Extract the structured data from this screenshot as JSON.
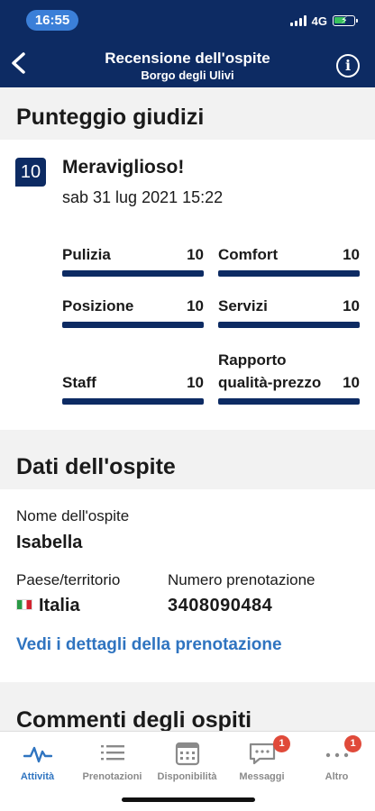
{
  "status": {
    "time": "16:55",
    "network": "4G"
  },
  "header": {
    "title": "Recensione dell'ospite",
    "subtitle": "Borgo degli Ulivi"
  },
  "scores": {
    "section_title": "Punteggio giudizi",
    "overall": "10",
    "overall_label": "Meraviglioso!",
    "date": "sab 31 lug 2021 15:22",
    "criteria": [
      {
        "label": "Pulizia",
        "value": "10",
        "fill": 1.0
      },
      {
        "label": "Comfort",
        "value": "10",
        "fill": 1.0
      },
      {
        "label": "Posizione",
        "value": "10",
        "fill": 1.0
      },
      {
        "label": "Servizi",
        "value": "10",
        "fill": 1.0
      },
      {
        "label": "Staff",
        "value": "10",
        "fill": 1.0
      },
      {
        "label": "Rapporto qualità-prezzo",
        "value": "10",
        "fill": 1.0
      }
    ]
  },
  "guest": {
    "section_title": "Dati dell'ospite",
    "name_label": "Nome dell'ospite",
    "name": "Isabella",
    "country_label": "Paese/territorio",
    "country": "Italia",
    "booking_label": "Numero prenotazione",
    "booking_number": "3408090484",
    "details_link": "Vedi i dettagli della prenotazione"
  },
  "comments": {
    "section_title": "Commenti degli ospiti"
  },
  "tabbar": {
    "tabs": [
      {
        "label": "Attività",
        "icon": "activity-icon",
        "active": true
      },
      {
        "label": "Prenotazioni",
        "icon": "list-icon"
      },
      {
        "label": "Disponibilità",
        "icon": "calendar-icon"
      },
      {
        "label": "Messaggi",
        "icon": "chat-icon",
        "badge": "1"
      },
      {
        "label": "Altro",
        "icon": "more-icon",
        "badge": "1"
      }
    ]
  },
  "colors": {
    "brand": "#0d2b63",
    "link": "#2f74c0",
    "badge": "#e04a3a",
    "active_tab": "#2f74c0"
  }
}
